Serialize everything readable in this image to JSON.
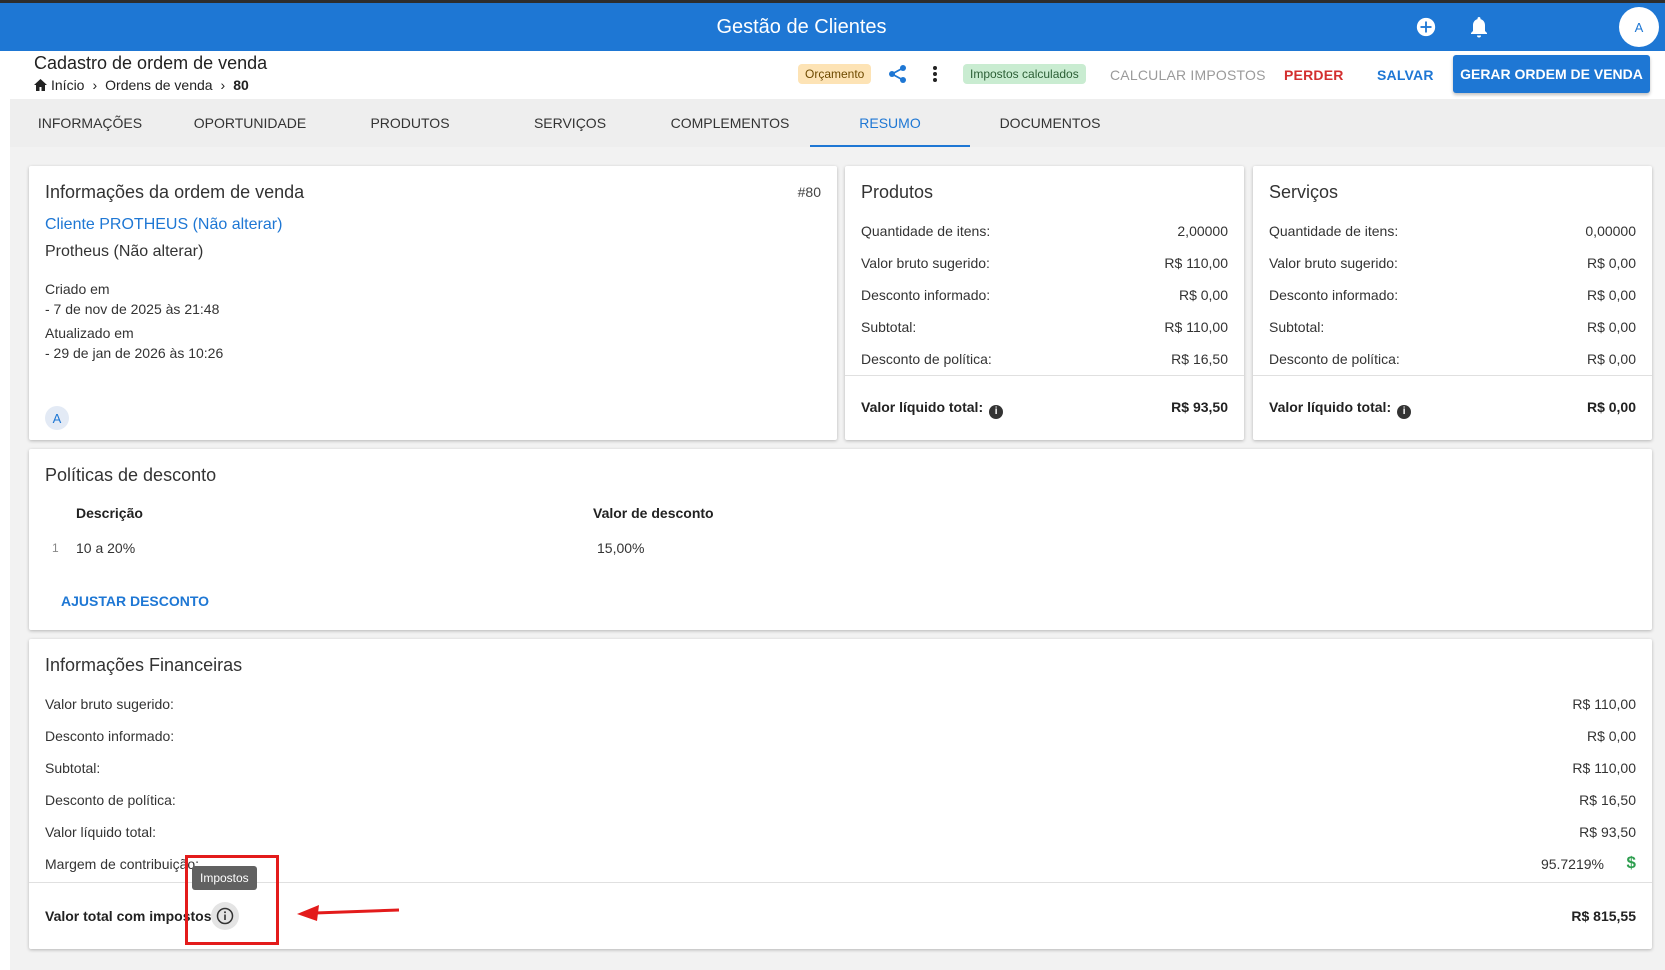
{
  "app": {
    "title": "Gestão de Clientes",
    "avatar": "A"
  },
  "icons": {
    "add": "add-circle-icon",
    "notifications": "bell-icon",
    "share": "share-icon",
    "more": "more-vertical-icon",
    "home": "home-icon",
    "info": "info-icon",
    "money": "dollar-icon"
  },
  "header": {
    "title": "Cadastro de ordem de venda",
    "breadcrumb": {
      "home": "Início",
      "list": "Ordens de venda",
      "current": "80"
    },
    "status_chip": "Orçamento",
    "tax_chip": "Impostos calculados",
    "calc_label": "CALCULAR IMPOSTOS",
    "lose_label": "PERDER",
    "save_label": "SALVAR",
    "generate_label": "GERAR ORDEM DE VENDA"
  },
  "tabs": [
    "INFORMAÇÕES",
    "OPORTUNIDADE",
    "PRODUTOS",
    "SERVIÇOS",
    "COMPLEMENTOS",
    "RESUMO",
    "DOCUMENTOS"
  ],
  "order_info": {
    "title": "Informações da ordem de venda",
    "number": "#80",
    "client_link": "Cliente PROTHEUS (Não alterar)",
    "client_name": "Protheus (Não alterar)",
    "created_label": "Criado em",
    "created_value": "- 7 de nov de 2025 às 21:48",
    "updated_label": "Atualizado em",
    "updated_value": "- 29 de jan de 2026 às 10:26",
    "avatar": "A"
  },
  "products": {
    "title": "Produtos",
    "rows": [
      {
        "label": "Quantidade de itens:",
        "value": "2,00000"
      },
      {
        "label": "Valor bruto sugerido:",
        "value": "R$ 110,00"
      },
      {
        "label": "Desconto informado:",
        "value": "R$ 0,00"
      },
      {
        "label": "Subtotal:",
        "value": "R$ 110,00"
      },
      {
        "label": "Desconto de política:",
        "value": "R$ 16,50"
      }
    ],
    "total_label": "Valor líquido total:",
    "total_value": "R$ 93,50"
  },
  "services": {
    "title": "Serviços",
    "rows": [
      {
        "label": "Quantidade de itens:",
        "value": "0,00000"
      },
      {
        "label": "Valor bruto sugerido:",
        "value": "R$ 0,00"
      },
      {
        "label": "Desconto informado:",
        "value": "R$ 0,00"
      },
      {
        "label": "Subtotal:",
        "value": "R$ 0,00"
      },
      {
        "label": "Desconto de política:",
        "value": "R$ 0,00"
      }
    ],
    "total_label": "Valor líquido total:",
    "total_value": "R$ 0,00"
  },
  "discounts": {
    "title": "Políticas de desconto",
    "col_desc": "Descrição",
    "col_value": "Valor de desconto",
    "rows": [
      {
        "index": "1",
        "desc": "10 a 20%",
        "value": "15,00%"
      }
    ],
    "adjust_label": "AJUSTAR DESCONTO"
  },
  "financial": {
    "title": "Informações Financeiras",
    "rows": [
      {
        "label": "Valor bruto sugerido:",
        "value": "R$ 110,00"
      },
      {
        "label": "Desconto informado:",
        "value": "R$ 0,00"
      },
      {
        "label": "Subtotal:",
        "value": "R$ 110,00"
      },
      {
        "label": "Desconto de política:",
        "value": "R$ 16,50"
      },
      {
        "label": "Valor líquido total:",
        "value": "R$ 93,50"
      }
    ],
    "margin_label": "Margem de contribuição:",
    "margin_value": "95.7219%",
    "total_tax_label": "Valor total com impostos:",
    "total_tax_value": "R$ 815,55",
    "tooltip": "Impostos"
  },
  "colors": {
    "primary": "#1e77d4",
    "danger": "#d32f2f",
    "highlight": "#e31b1b",
    "success": "#2e9e4f"
  }
}
